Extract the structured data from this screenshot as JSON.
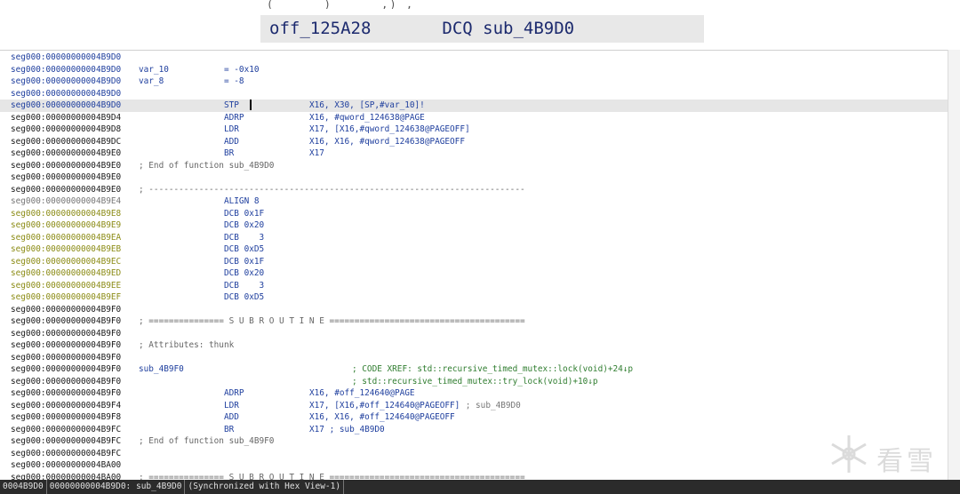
{
  "zoom": {
    "top_fragment": "( ‾‾‾‾   )   ‾‾‾‾   ,) ,",
    "label": "off_125A28",
    "mnemonic": "DCQ",
    "operand": "sub_4B9D0"
  },
  "rows": [
    {
      "addr": "seg000:00000000004B9D0",
      "kind": "code"
    },
    {
      "addr": "seg000:00000000004B9D0",
      "kind": "code",
      "label": "var_10",
      "mnem": "= -0x10"
    },
    {
      "addr": "seg000:00000000004B9D0",
      "kind": "code",
      "label": "var_8",
      "mnem": "= -8"
    },
    {
      "addr": "seg000:00000000004B9D0",
      "kind": "code"
    },
    {
      "addr": "seg000:00000000004B9D0",
      "kind": "code",
      "mnem": "STP",
      "ops": "X16, X30, [SP,#var_10]!",
      "current": true
    },
    {
      "addr": "seg000:00000000004B9D4",
      "kind": "plain",
      "mnem": "ADRP",
      "ops": "X16, #qword_124638@PAGE"
    },
    {
      "addr": "seg000:00000000004B9D8",
      "kind": "plain",
      "mnem": "LDR",
      "ops": "X17, [X16,#qword_124638@PAGEOFF]"
    },
    {
      "addr": "seg000:00000000004B9DC",
      "kind": "plain",
      "mnem": "ADD",
      "ops": "X16, X16, #qword_124638@PAGEOFF"
    },
    {
      "addr": "seg000:00000000004B9E0",
      "kind": "plain",
      "mnem": "BR",
      "ops": "X17"
    },
    {
      "addr": "seg000:00000000004B9E0",
      "kind": "plain",
      "comment": "; End of function sub_4B9D0"
    },
    {
      "addr": "seg000:00000000004B9E0",
      "kind": "plain"
    },
    {
      "addr": "seg000:00000000004B9E0",
      "kind": "plain",
      "comment": "; ---------------------------------------------------------------------------"
    },
    {
      "addr": "seg000:00000000004B9E4",
      "kind": "gray",
      "mnem": "ALIGN 8"
    },
    {
      "addr": "seg000:00000000004B9E8",
      "kind": "data",
      "mnem": "DCB 0x1F"
    },
    {
      "addr": "seg000:00000000004B9E9",
      "kind": "data",
      "mnem": "DCB 0x20"
    },
    {
      "addr": "seg000:00000000004B9EA",
      "kind": "data",
      "mnem": "DCB    3"
    },
    {
      "addr": "seg000:00000000004B9EB",
      "kind": "data",
      "mnem": "DCB 0xD5"
    },
    {
      "addr": "seg000:00000000004B9EC",
      "kind": "data",
      "mnem": "DCB 0x1F"
    },
    {
      "addr": "seg000:00000000004B9ED",
      "kind": "data",
      "mnem": "DCB 0x20"
    },
    {
      "addr": "seg000:00000000004B9EE",
      "kind": "data",
      "mnem": "DCB    3"
    },
    {
      "addr": "seg000:00000000004B9EF",
      "kind": "data",
      "mnem": "DCB 0xD5"
    },
    {
      "addr": "seg000:00000000004B9F0",
      "kind": "plain"
    },
    {
      "addr": "seg000:00000000004B9F0",
      "kind": "plain",
      "comment": "; =============== S U B R O U T I N E ======================================="
    },
    {
      "addr": "seg000:00000000004B9F0",
      "kind": "plain"
    },
    {
      "addr": "seg000:00000000004B9F0",
      "kind": "plain",
      "comment": "; Attributes: thunk"
    },
    {
      "addr": "seg000:00000000004B9F0",
      "kind": "plain"
    },
    {
      "addr": "seg000:00000000004B9F0",
      "kind": "plain",
      "label": "sub_4B9F0",
      "xref": "; CODE XREF: std::recursive_timed_mutex::lock(void)+24↓p"
    },
    {
      "addr": "seg000:00000000004B9F0",
      "kind": "plain",
      "xref": "; std::recursive_timed_mutex::try_lock(void)+10↓p"
    },
    {
      "addr": "seg000:00000000004B9F0",
      "kind": "plain",
      "mnem": "ADRP",
      "ops": "X16, #off_124640@PAGE"
    },
    {
      "addr": "seg000:00000000004B9F4",
      "kind": "plain",
      "mnem": "LDR",
      "ops": "X17, [X16,#off_124640@PAGEOFF]",
      "ops_comment": " ; sub_4B9D0"
    },
    {
      "addr": "seg000:00000000004B9F8",
      "kind": "plain",
      "mnem": "ADD",
      "ops": "X16, X16, #off_124640@PAGEOFF"
    },
    {
      "addr": "seg000:00000000004B9FC",
      "kind": "plain",
      "mnem": "BR",
      "ops": "X17 ; sub_4B9D0"
    },
    {
      "addr": "seg000:00000000004B9FC",
      "kind": "plain",
      "comment": "; End of function sub_4B9F0"
    },
    {
      "addr": "seg000:00000000004B9FC",
      "kind": "plain"
    },
    {
      "addr": "seg000:00000000004BA00",
      "kind": "plain"
    },
    {
      "addr": "seg000:00000000004BA00",
      "kind": "plain",
      "comment": "; =============== S U B R O U T I N E ======================================="
    }
  ],
  "status": {
    "cell1": "0004B9D0",
    "cell2": "00000000004B9D0: sub_4B9D0",
    "cell3": "(Synchronized with Hex View-1)"
  },
  "watermark": {
    "text": "看雪"
  }
}
